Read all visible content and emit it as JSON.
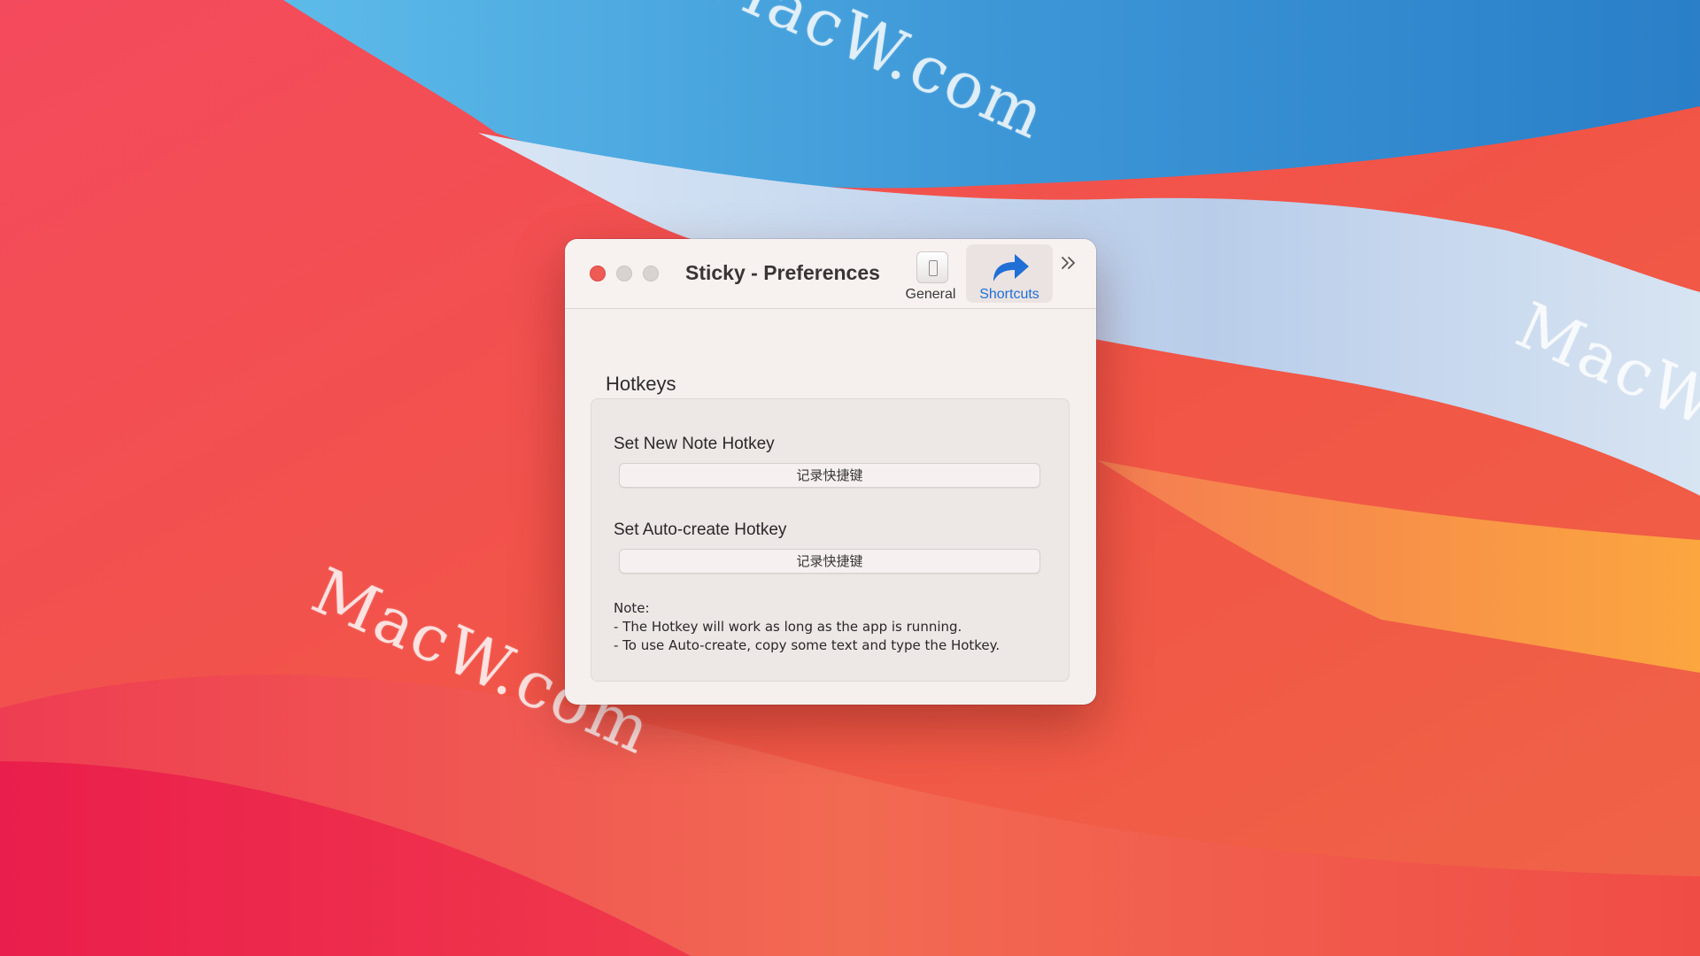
{
  "desktop": {
    "watermarks": [
      "MacW.com",
      "MacW.com",
      "MacW.com"
    ]
  },
  "window": {
    "title": "Sticky - Preferences",
    "toolbar": {
      "tabs": [
        {
          "label": "General",
          "icon": "switch-icon",
          "selected": false
        },
        {
          "label": "Shortcuts",
          "icon": "share-arrow-icon",
          "selected": true
        }
      ],
      "overflow_icon": "chevron-double-right-icon"
    },
    "section_title": "Hotkeys",
    "hotkeys": [
      {
        "label": "Set New Note Hotkey",
        "button_label": "记录快捷键"
      },
      {
        "label": "Set Auto-create Hotkey",
        "button_label": "记录快捷键"
      }
    ],
    "note": {
      "title": "Note:",
      "lines": [
        "- The Hotkey will work as long as the app is running.",
        "- To use Auto-create, copy some text and type the Hotkey."
      ]
    }
  },
  "colors": {
    "accent": "#1f6fd6",
    "close_button": "#ee5b55"
  }
}
